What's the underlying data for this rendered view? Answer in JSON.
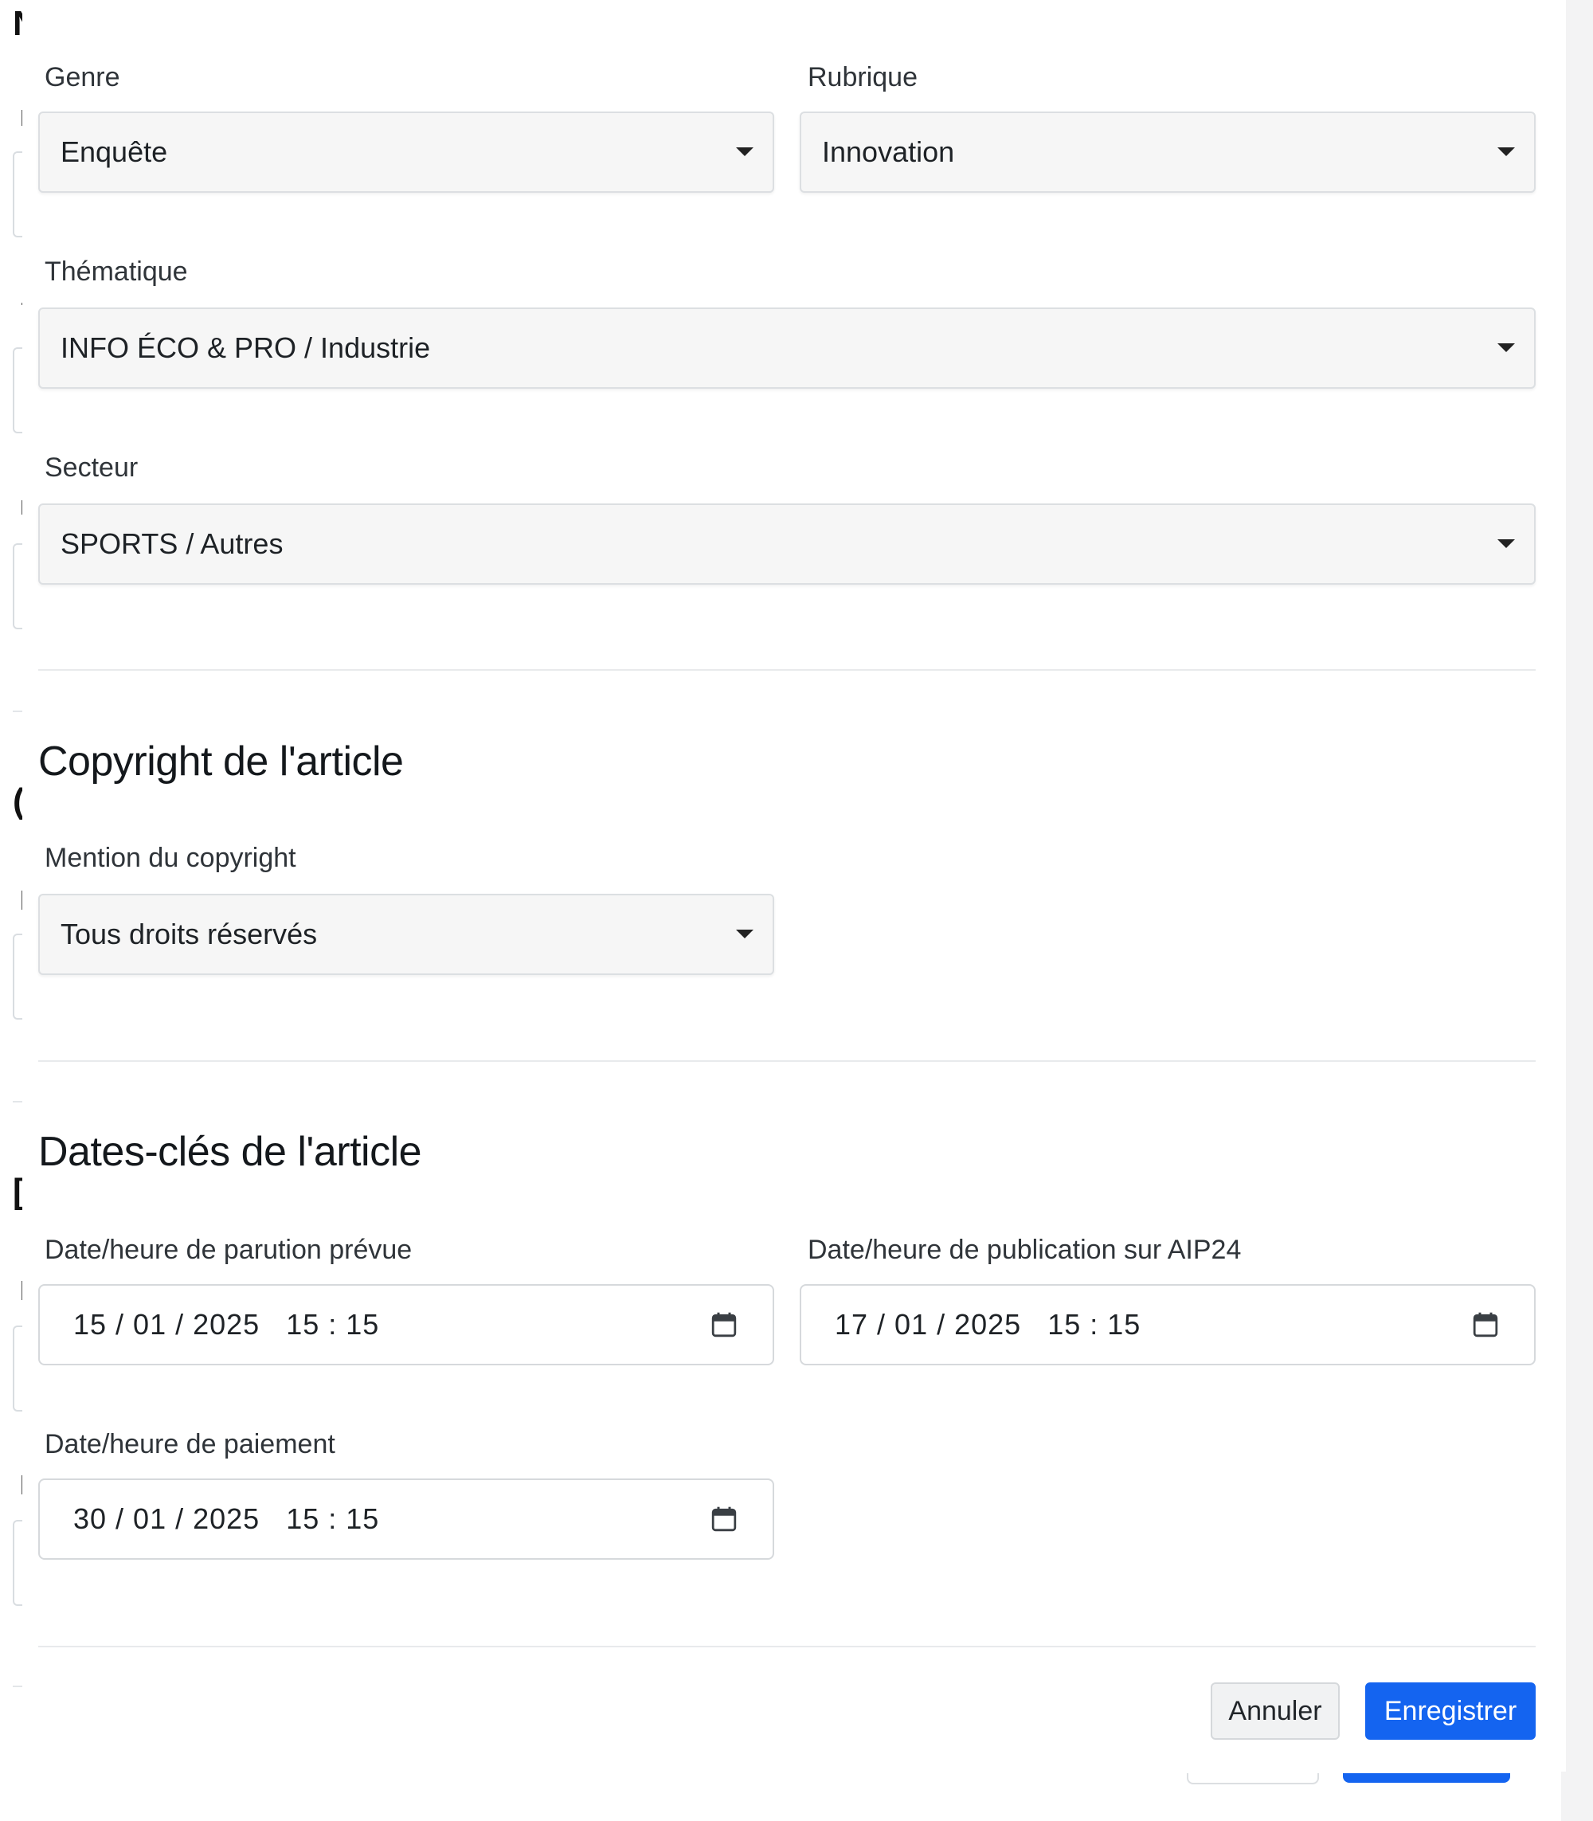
{
  "form": {
    "genre": {
      "label": "Genre",
      "value": "Enquête"
    },
    "rubrique": {
      "label": "Rubrique",
      "value": "Innovation"
    },
    "thematique": {
      "label": "Thématique",
      "value": "INFO ÉCO & PRO / Industrie"
    },
    "secteur": {
      "label": "Secteur",
      "value": "SPORTS / Autres"
    }
  },
  "copyright": {
    "title": "Copyright de l'article",
    "mention": {
      "label": "Mention du copyright",
      "value": "Tous droits réservés"
    }
  },
  "dates": {
    "title": "Dates-clés de l'article",
    "parution": {
      "label": "Date/heure de parution prévue",
      "value": "15 / 01 / 2025   15 : 15"
    },
    "publication": {
      "label": "Date/heure de publication sur AIP24",
      "value": "17 / 01 / 2025   15 : 15"
    },
    "paiement": {
      "label": "Date/heure de paiement",
      "value": "30 / 01 / 2025   15 : 15"
    }
  },
  "footer": {
    "cancel_label": "Annuler",
    "save_label": "Enregistrer"
  },
  "icons": {
    "select_caret": "chevron-down-icon",
    "date_picker": "calendar-icon"
  },
  "colors": {
    "primary": "#1464f0",
    "select_bg": "#f6f6f6",
    "border": "#dcdfe2"
  }
}
